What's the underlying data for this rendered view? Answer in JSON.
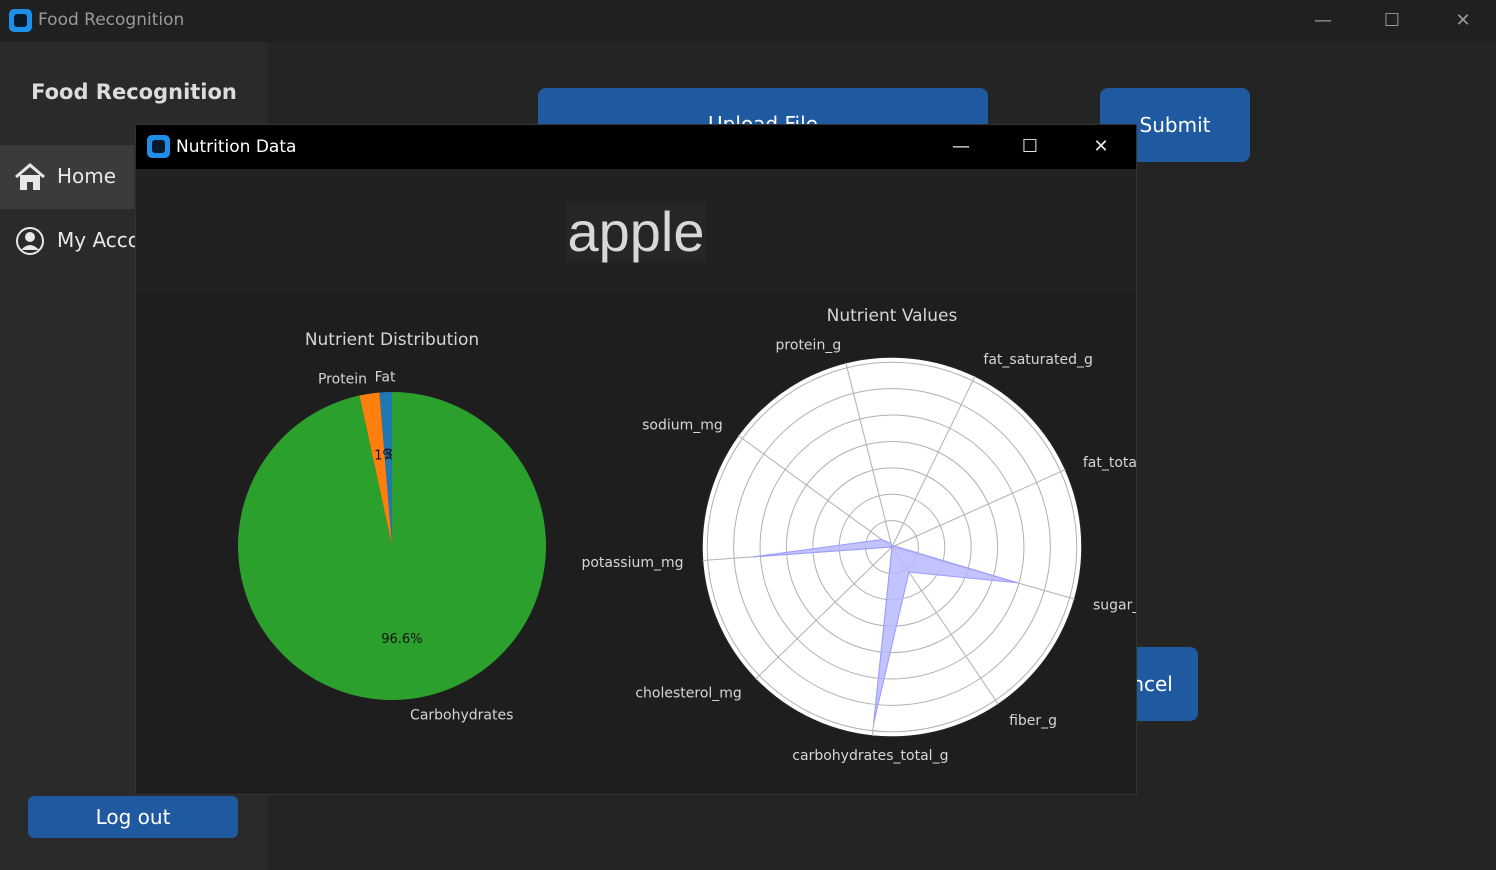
{
  "window": {
    "title": "Food Recognition"
  },
  "sidebar": {
    "brand": "Food Recognition",
    "items": [
      {
        "label": "Home",
        "icon": "home-icon",
        "active": true
      },
      {
        "label": "My Account",
        "icon": "user-circle-icon",
        "active": false
      }
    ],
    "logout_label": "Log out"
  },
  "main": {
    "upload_label": "Upload File",
    "submit_label": "Submit",
    "cancel_label": "Cancel"
  },
  "modal": {
    "title": "Nutrition Data",
    "food_name": "apple"
  },
  "colors": {
    "accent_blue": "#1f5aa0",
    "pie_protein": "#ff7f0e",
    "pie_fat": "#1f77b4",
    "pie_carbs": "#2ca02c",
    "radar_fill": "#b8b8ff"
  },
  "chart_data": [
    {
      "type": "pie",
      "title": "Nutrient Distribution",
      "labels": [
        "Protein",
        "Fat",
        "Carbohydrates"
      ],
      "values": [
        2.1,
        1.3,
        96.6
      ],
      "value_labels": [
        "2.1%",
        "1.3%",
        "96.6%"
      ],
      "start_angle_deg": 90,
      "direction": "counterclockwise"
    },
    {
      "type": "radar",
      "title": "Nutrient Values",
      "axes": [
        "fat_total_g",
        "fat_saturated_g",
        "protein_g",
        "sodium_mg",
        "potassium_mg",
        "cholesterol_mg",
        "carbohydrates_total_g",
        "fiber_g",
        "sugar_g"
      ],
      "values": [
        0.2,
        0.0,
        0.3,
        1.0,
        11.0,
        0.0,
        14.0,
        2.4,
        10.3
      ],
      "rmax": 15,
      "grid": true
    }
  ]
}
